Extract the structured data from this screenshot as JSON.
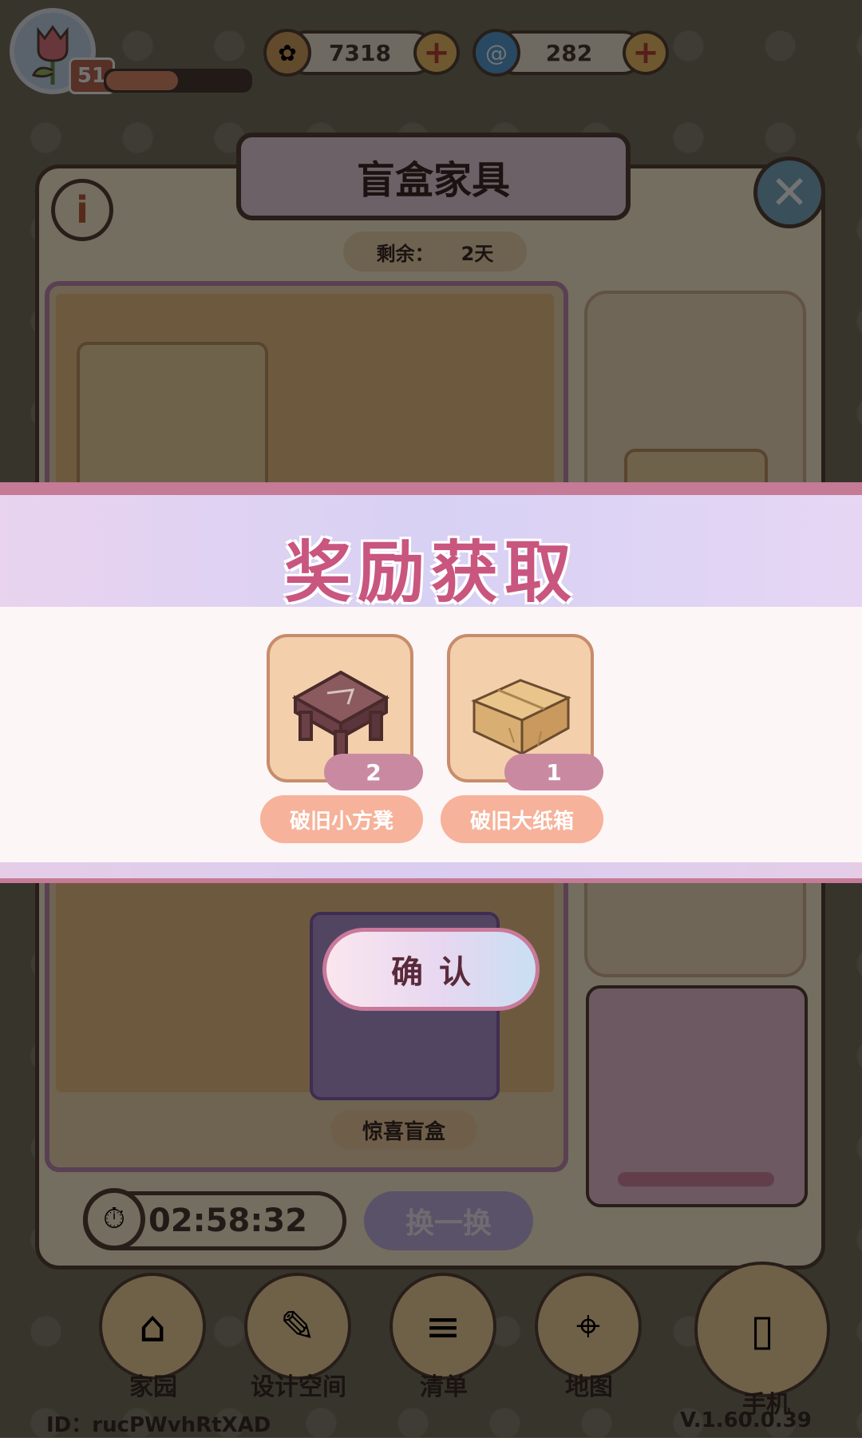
{
  "hud": {
    "level": "51",
    "xp_progress": 0.5,
    "coins": "7318",
    "gems": "282"
  },
  "modal": {
    "title": "盲盒家具",
    "info_glyph": "i",
    "close_glyph": "✕",
    "remain_label": "剩余：",
    "remain_value": "2天",
    "box_label": "惊喜盲盒",
    "timer": "02:58:32",
    "swap_label": "换一换"
  },
  "reward": {
    "title": "奖励获取",
    "items": [
      {
        "name": "破旧小方凳",
        "count": "2",
        "icon": "stool-icon"
      },
      {
        "name": "破旧大纸箱",
        "count": "1",
        "icon": "cardboard-box-icon"
      }
    ],
    "confirm_label": "确认"
  },
  "nav": {
    "items": [
      {
        "label": "家园",
        "icon": "home-icon"
      },
      {
        "label": "设计空间",
        "icon": "design-icon"
      },
      {
        "label": "清单",
        "icon": "list-icon"
      },
      {
        "label": "地图",
        "icon": "map-icon"
      },
      {
        "label": "手机",
        "icon": "phone-icon"
      }
    ],
    "id_text": "ID：rucPWvhRtXAD",
    "version": "V.1.60.0.39"
  },
  "colors": {
    "accent_pink": "#c9567f",
    "badge": "#c98aa1",
    "item_name_bg": "#f6b29a"
  }
}
